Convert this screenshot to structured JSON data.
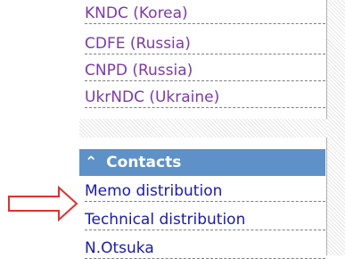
{
  "links": [
    {
      "label": "KNDC (Korea)"
    },
    {
      "label": "CDFE (Russia)"
    },
    {
      "label": "CNPD (Russia)"
    },
    {
      "label": "UkrNDC (Ukraine)"
    }
  ],
  "contacts": {
    "header": "Contacts",
    "items": [
      {
        "label": "Memo distribution"
      },
      {
        "label": "Technical distribution"
      },
      {
        "label": "N.Otsuka"
      }
    ]
  },
  "colors": {
    "visited_link": "#7b3aa8",
    "link": "#1a1ab0",
    "header_bg": "#5e91c8",
    "arrow": "#e03030"
  },
  "icons": {
    "collapse": "double-chevron-up-icon",
    "pointer": "right-arrow-icon"
  }
}
